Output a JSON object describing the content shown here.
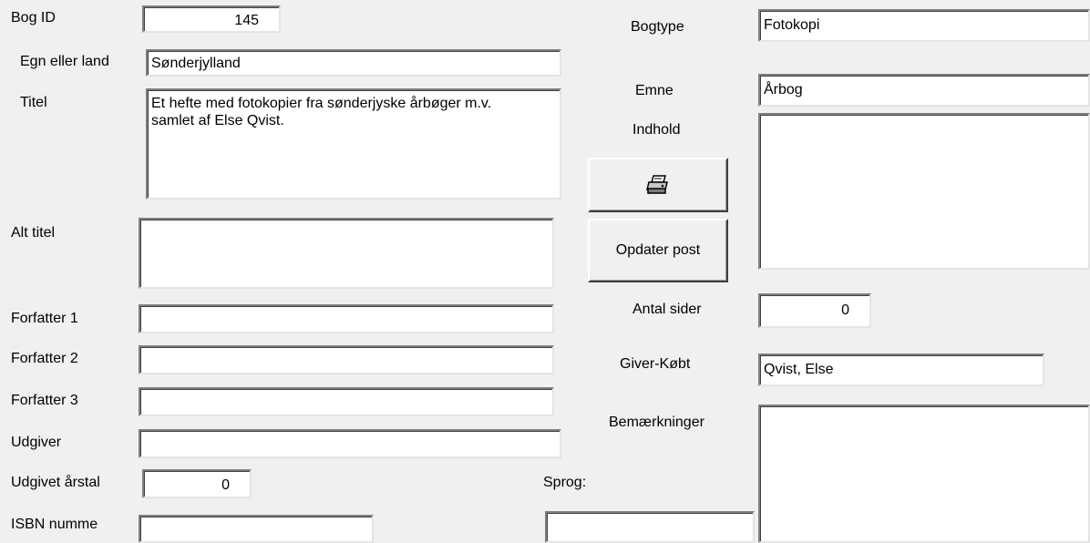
{
  "labels": {
    "bog_id": "Bog ID",
    "egn": "Egn eller land",
    "titel": "Titel",
    "alt_titel": "Alt titel",
    "forfatter1": "Forfatter 1",
    "forfatter2": "Forfatter 2",
    "forfatter3": "Forfatter 3",
    "udgiver": "Udgiver",
    "udgivet_aarstal": "Udgivet årstal",
    "isbn": "ISBN numme",
    "sprog": "Sprog:",
    "bogtype": "Bogtype",
    "emne": "Emne",
    "indhold": "Indhold",
    "antal_sider": "Antal sider",
    "giver_koebt": "Giver-Købt",
    "bemaerkninger": "Bemærkninger"
  },
  "values": {
    "bog_id": "145",
    "egn": "Sønderjylland",
    "titel": "Et hefte med fotokopier fra sønderjyske årbøger m.v. samlet af Else Qvist.",
    "alt_titel": "",
    "forfatter1": "",
    "forfatter2": "",
    "forfatter3": "",
    "udgiver": "",
    "udgivet_aarstal": "0",
    "isbn": "",
    "sprog": "",
    "bogtype": "Fotokopi",
    "emne": "Årbog",
    "indhold": "",
    "antal_sider": "0",
    "giver_koebt": "Qvist, Else",
    "bemaerkninger": ""
  },
  "buttons": {
    "print_icon": "printer-icon",
    "update": "Opdater post"
  }
}
